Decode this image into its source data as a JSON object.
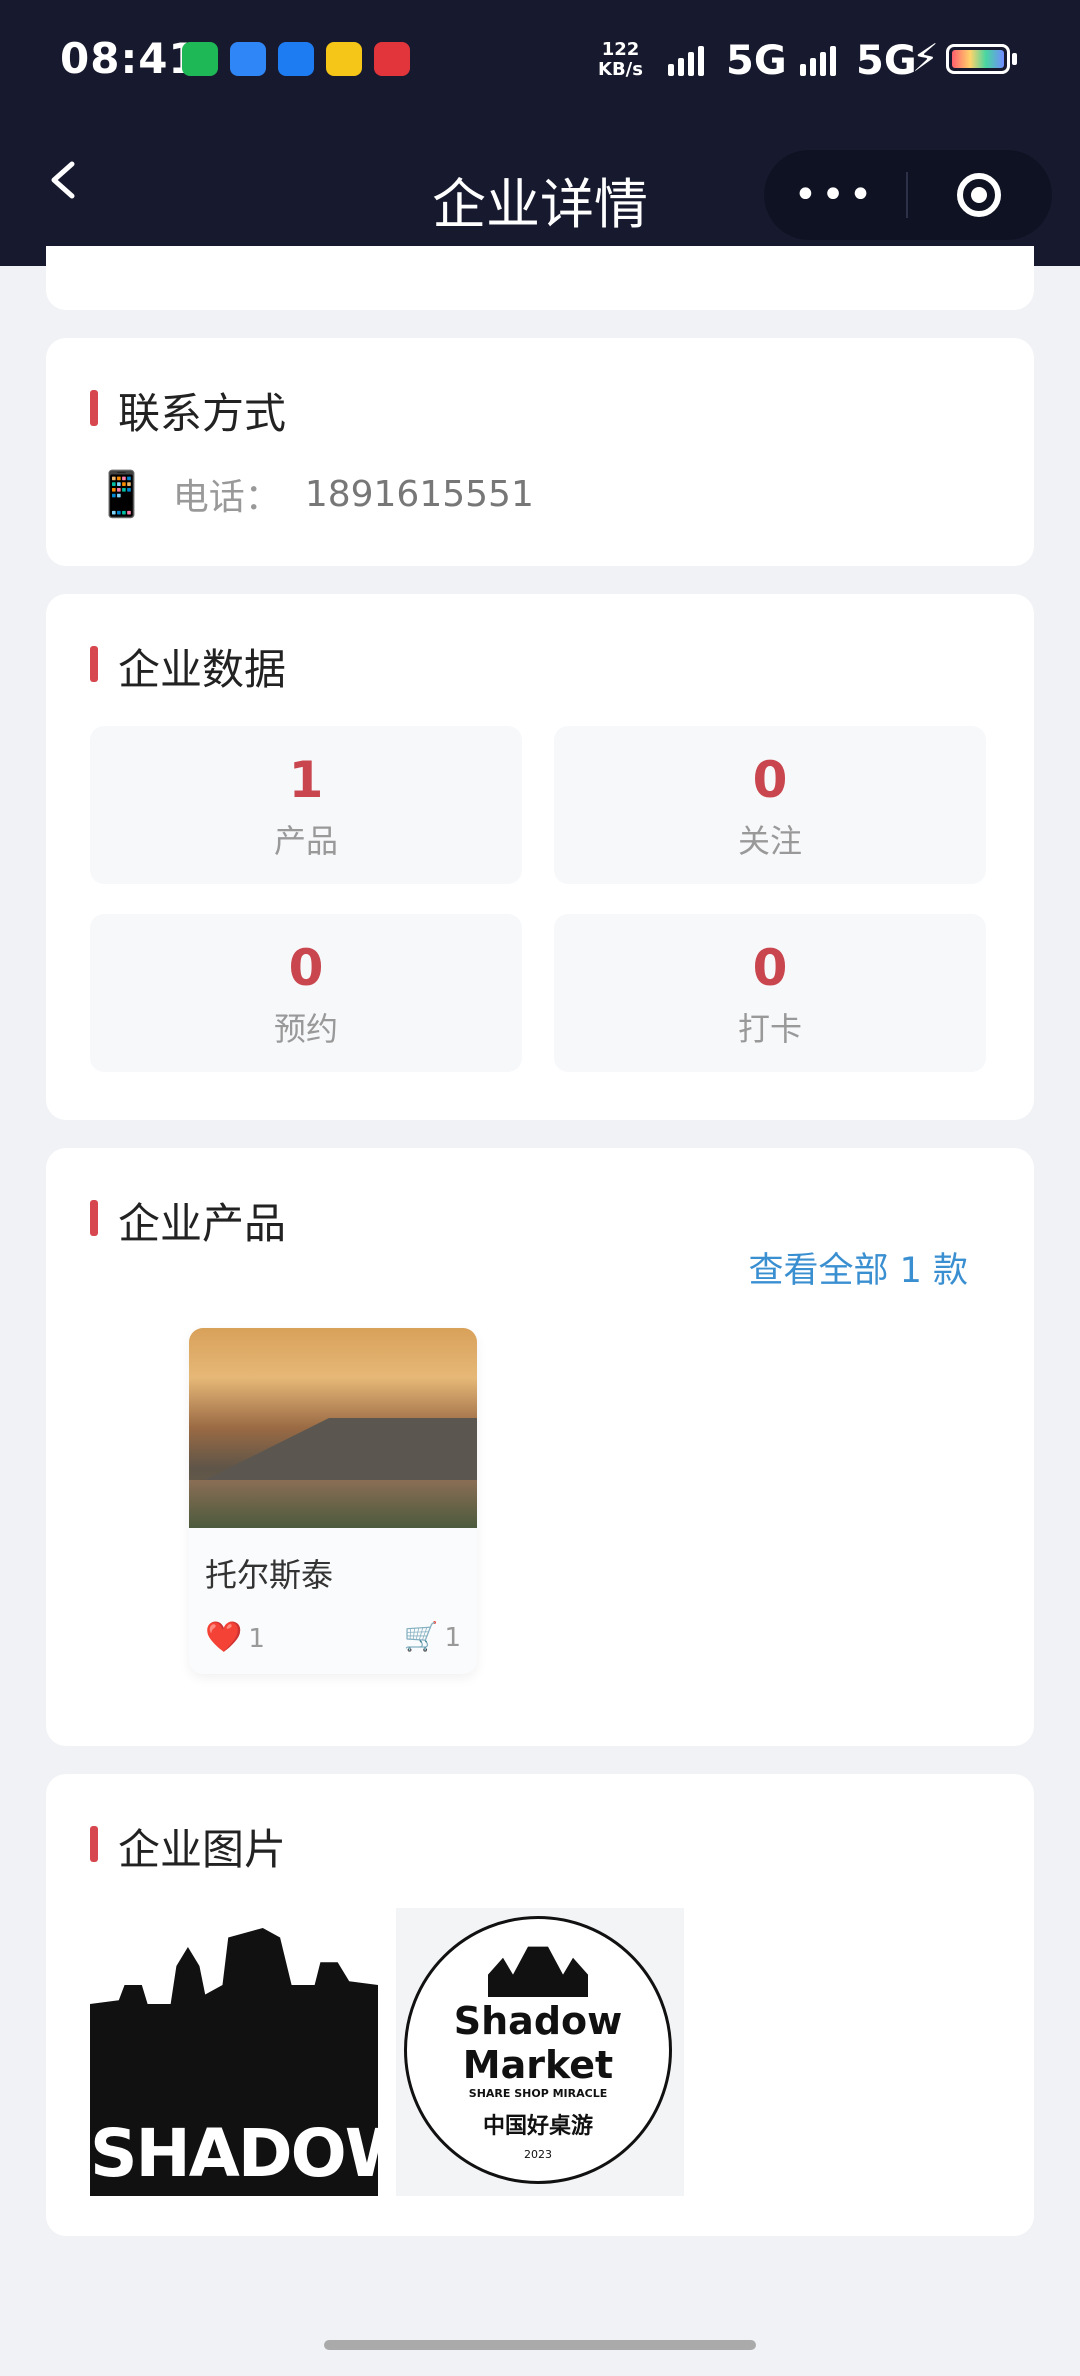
{
  "status_bar": {
    "time": "08:41",
    "net_speed_value": "122",
    "net_speed_unit": "KB/s",
    "signal1": "5G",
    "signal2": "5G",
    "app_icon_colors": [
      "#1fb856",
      "#2f86f6",
      "#1e7cf2",
      "#f5c518",
      "#e2353b"
    ]
  },
  "nav": {
    "title": "企业详情",
    "more_icon": "•••",
    "icons": [
      "back-chevron-icon",
      "more-dots-icon",
      "target-circle-icon"
    ]
  },
  "contact": {
    "title": "联系方式",
    "phone_icon": "📱",
    "phone_label": "电话：",
    "phone_value": "1891615551"
  },
  "stats": {
    "title": "企业数据",
    "items": [
      {
        "value": "1",
        "label": "产品"
      },
      {
        "value": "0",
        "label": "关注"
      },
      {
        "value": "0",
        "label": "预约"
      },
      {
        "value": "0",
        "label": "打卡"
      }
    ],
    "accent": "#c9464e"
  },
  "products": {
    "title": "企业产品",
    "view_all": "查看全部 1 款",
    "items": [
      {
        "name": "托尔斯泰",
        "likes": "1",
        "cart": "1",
        "like_icon": "❤️",
        "cart_icon": "🛒"
      }
    ]
  },
  "gallery": {
    "title": "企业图片",
    "images": [
      {
        "word": "SHADOW"
      },
      {
        "line1": "Shadow",
        "line2": "Market",
        "tagline": "SHARE SHOP MIRACLE",
        "cn": "中国好桌游",
        "year": "2023"
      }
    ]
  }
}
